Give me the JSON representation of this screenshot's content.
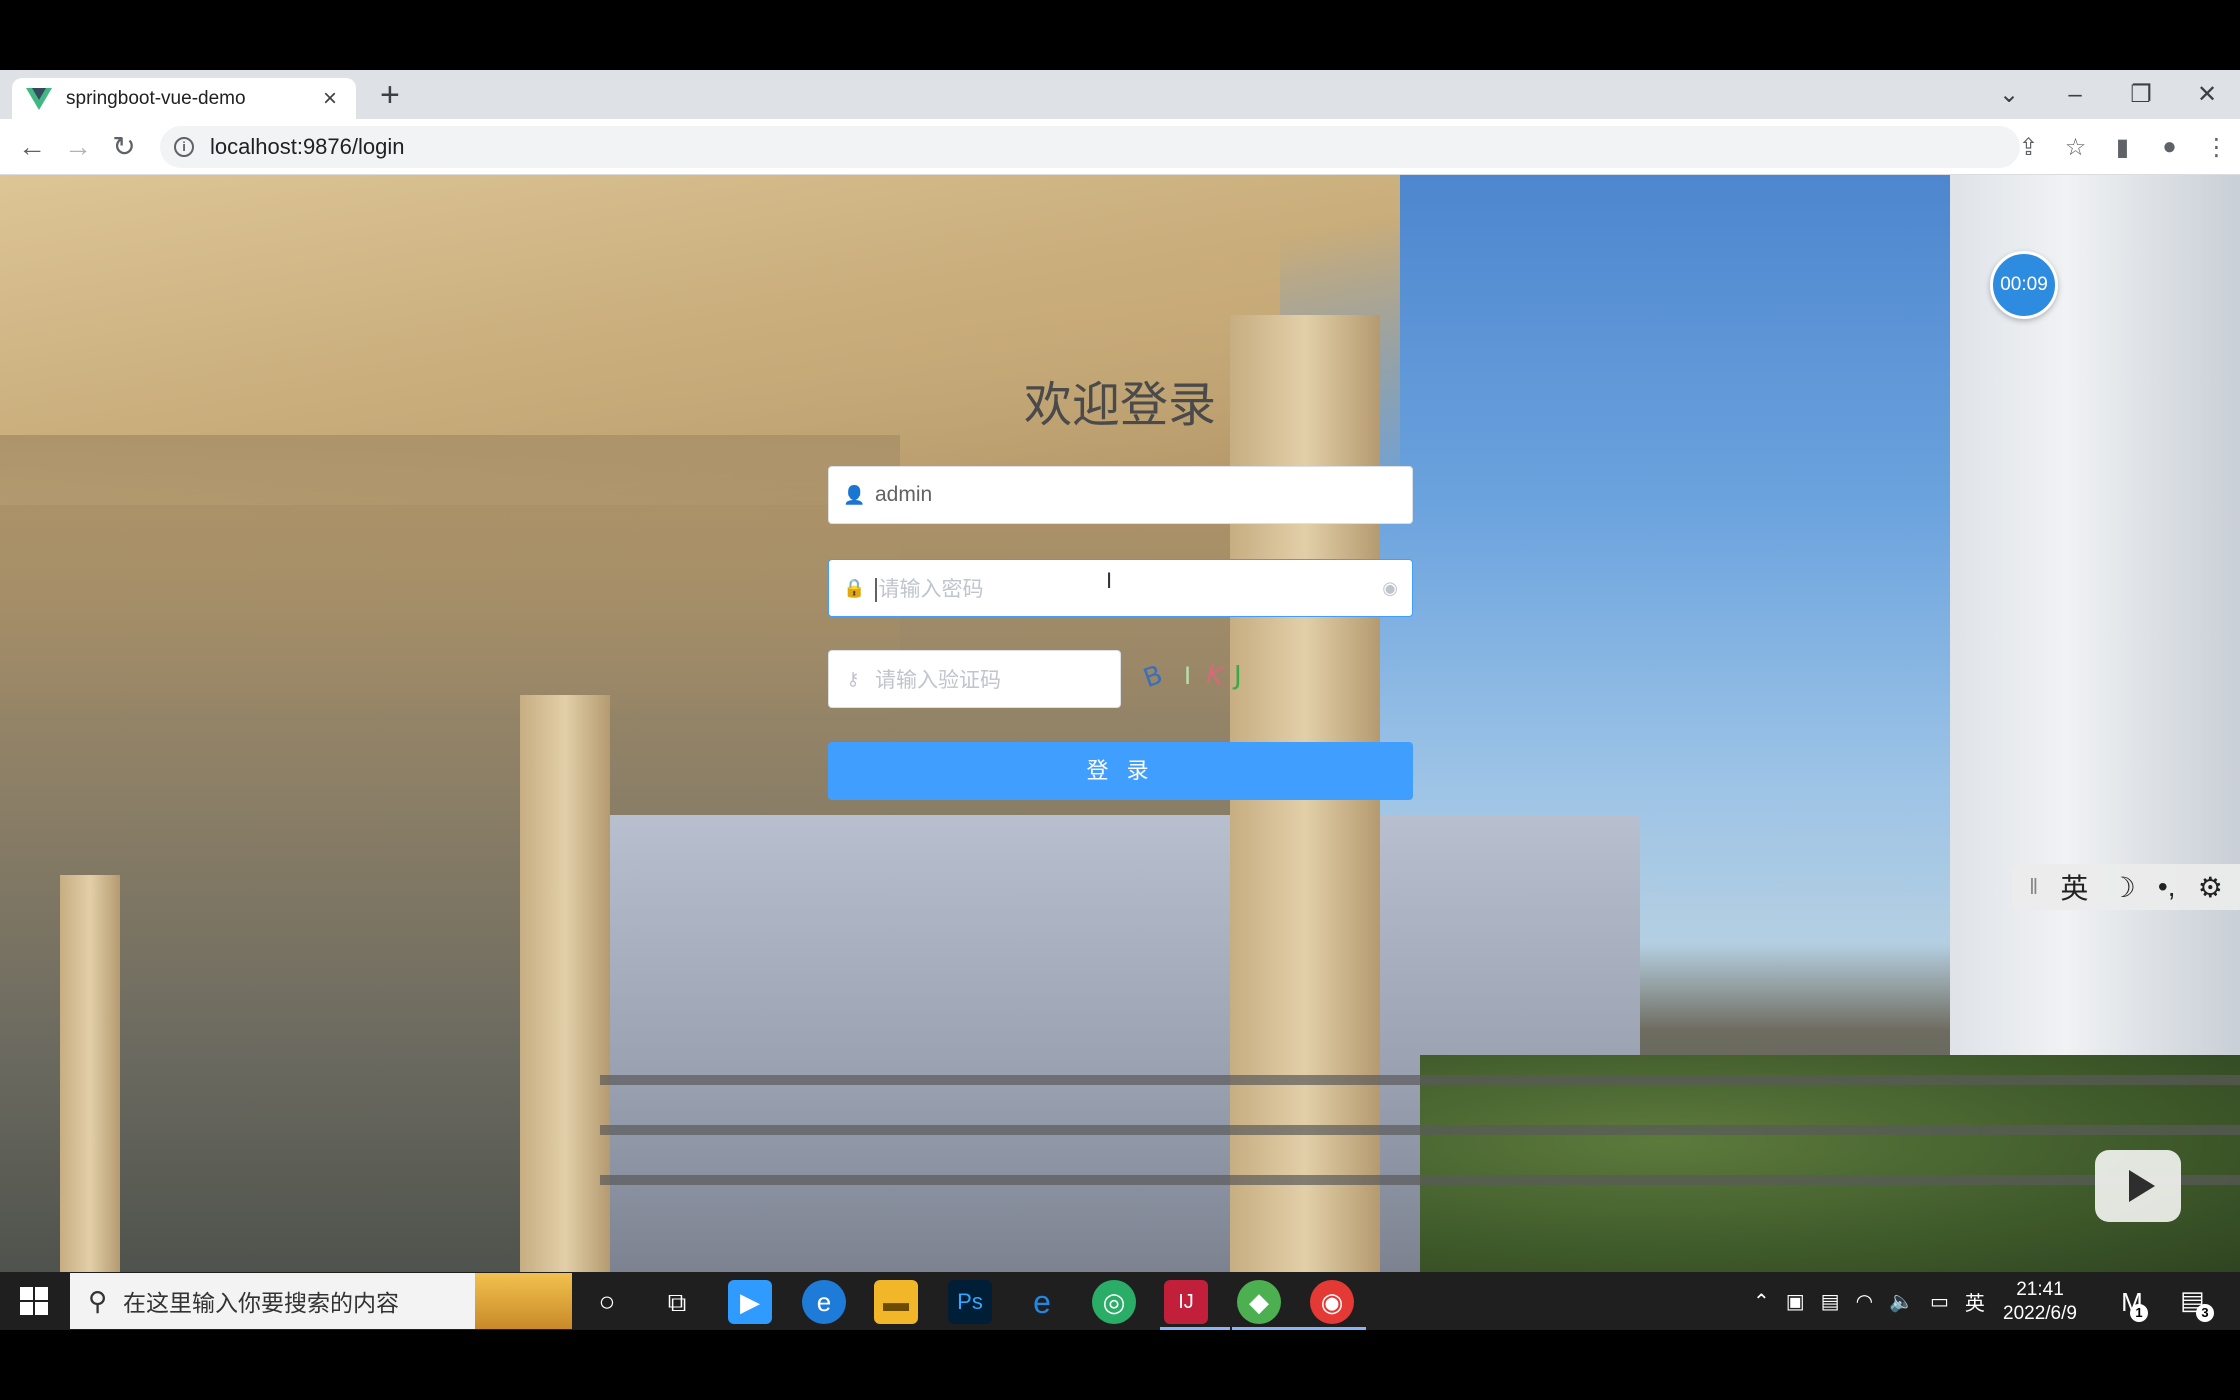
{
  "browser": {
    "tab": {
      "title": "springboot-vue-demo"
    },
    "address_bar": {
      "url": "localhost:9876/login"
    }
  },
  "page": {
    "title": "欢迎登录",
    "username": {
      "value": "admin"
    },
    "password": {
      "placeholder": "请输入密码"
    },
    "captcha_input": {
      "placeholder": "请输入验证码"
    },
    "login_button": "登 录",
    "timer": "00:09"
  },
  "ime": {
    "lang": "英",
    "moon": "☽",
    "punct": "•,",
    "gear": "⚙"
  },
  "taskbar": {
    "search_placeholder": "在这里输入你要搜索的内容",
    "ime_lang": "英",
    "time": "21:41",
    "date": "2022/6/9",
    "notification_count": "3",
    "badge_count": "1"
  },
  "colors": {
    "primary": "#409eff",
    "taskbar": "#1f1f1f"
  }
}
